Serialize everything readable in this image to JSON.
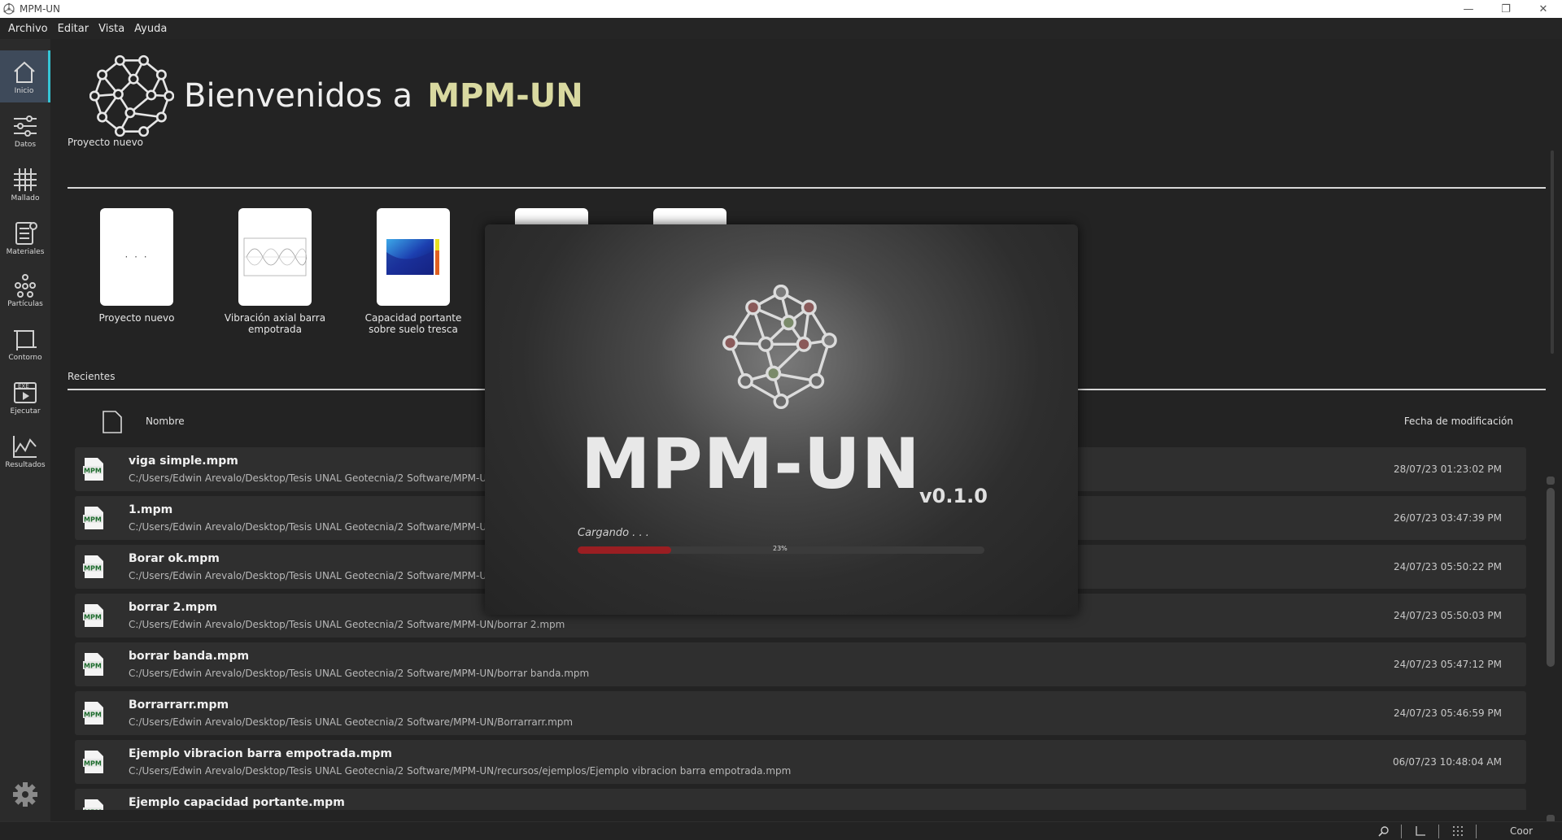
{
  "window": {
    "title": "MPM-UN",
    "controls": [
      "—",
      "❐",
      "✕"
    ]
  },
  "menu": [
    "Archivo",
    "Editar",
    "Vista",
    "Ayuda"
  ],
  "sidebar": {
    "items": [
      {
        "label": "Inicio",
        "icon": "home-icon"
      },
      {
        "label": "Datos",
        "icon": "sliders-icon"
      },
      {
        "label": "Mallado",
        "icon": "grid-icon"
      },
      {
        "label": "Materiales",
        "icon": "layers-icon"
      },
      {
        "label": "Partículas",
        "icon": "particles-icon"
      },
      {
        "label": "Contorno",
        "icon": "boundary-icon"
      },
      {
        "label": "Ejecutar",
        "icon": "exe-icon"
      },
      {
        "label": "Resultados",
        "icon": "chart-icon"
      }
    ],
    "settings_icon": "gear-icon"
  },
  "welcome": {
    "prefix": "Bienvenidos a",
    "brand": "MPM-UN"
  },
  "new_project": {
    "title": "Proyecto nuevo",
    "templates": [
      {
        "label": "Proyecto nuevo",
        "card_text": "· · ·"
      },
      {
        "label": "Vibración axial barra empotrada"
      },
      {
        "label": "Capacidad portante sobre suelo tresca"
      },
      {
        "label": ""
      },
      {
        "label": ""
      }
    ]
  },
  "recent": {
    "title": "Recientes",
    "col_name": "Nombre",
    "col_date": "Fecha de modificación",
    "file_badge": "MPM",
    "files": [
      {
        "name": "viga simple.mpm",
        "path": "C:/Users/Edwin Arevalo/Desktop/Tesis UNAL Geotecnia/2 Software/MPM-UN/viga simple.mpm",
        "date": "28/07/23 01:23:02 PM"
      },
      {
        "name": "1.mpm",
        "path": "C:/Users/Edwin Arevalo/Desktop/Tesis UNAL Geotecnia/2 Software/MPM-UN/1.mpm",
        "date": "26/07/23 03:47:39 PM"
      },
      {
        "name": "Borar ok.mpm",
        "path": "C:/Users/Edwin Arevalo/Desktop/Tesis UNAL Geotecnia/2 Software/MPM-UN/Borar ok.mpm",
        "date": "24/07/23 05:50:22 PM"
      },
      {
        "name": "borrar 2.mpm",
        "path": "C:/Users/Edwin Arevalo/Desktop/Tesis UNAL Geotecnia/2 Software/MPM-UN/borrar 2.mpm",
        "date": "24/07/23 05:50:03 PM"
      },
      {
        "name": "borrar banda.mpm",
        "path": "C:/Users/Edwin Arevalo/Desktop/Tesis UNAL Geotecnia/2 Software/MPM-UN/borrar banda.mpm",
        "date": "24/07/23 05:47:12 PM"
      },
      {
        "name": "Borrarrarr.mpm",
        "path": "C:/Users/Edwin Arevalo/Desktop/Tesis UNAL Geotecnia/2 Software/MPM-UN/Borrarrarr.mpm",
        "date": "24/07/23 05:46:59 PM"
      },
      {
        "name": "Ejemplo vibracion barra empotrada.mpm",
        "path": "C:/Users/Edwin Arevalo/Desktop/Tesis UNAL Geotecnia/2 Software/MPM-UN/recursos/ejemplos/Ejemplo vibracion barra empotrada.mpm",
        "date": "06/07/23 10:48:04 AM"
      },
      {
        "name": "Ejemplo capacidad portante.mpm",
        "path": "",
        "date": ""
      }
    ]
  },
  "splash": {
    "name": "MPM-UN",
    "version": "v0.1.0",
    "loading_text": "Cargando . . .",
    "progress_percent": 23,
    "progress_label": "23%",
    "progress_color": "#9a1e22"
  },
  "statusbar": {
    "icons": [
      "zoom-icon",
      "axes-icon",
      "grid-dots-icon"
    ],
    "coord_label": "Coor"
  }
}
